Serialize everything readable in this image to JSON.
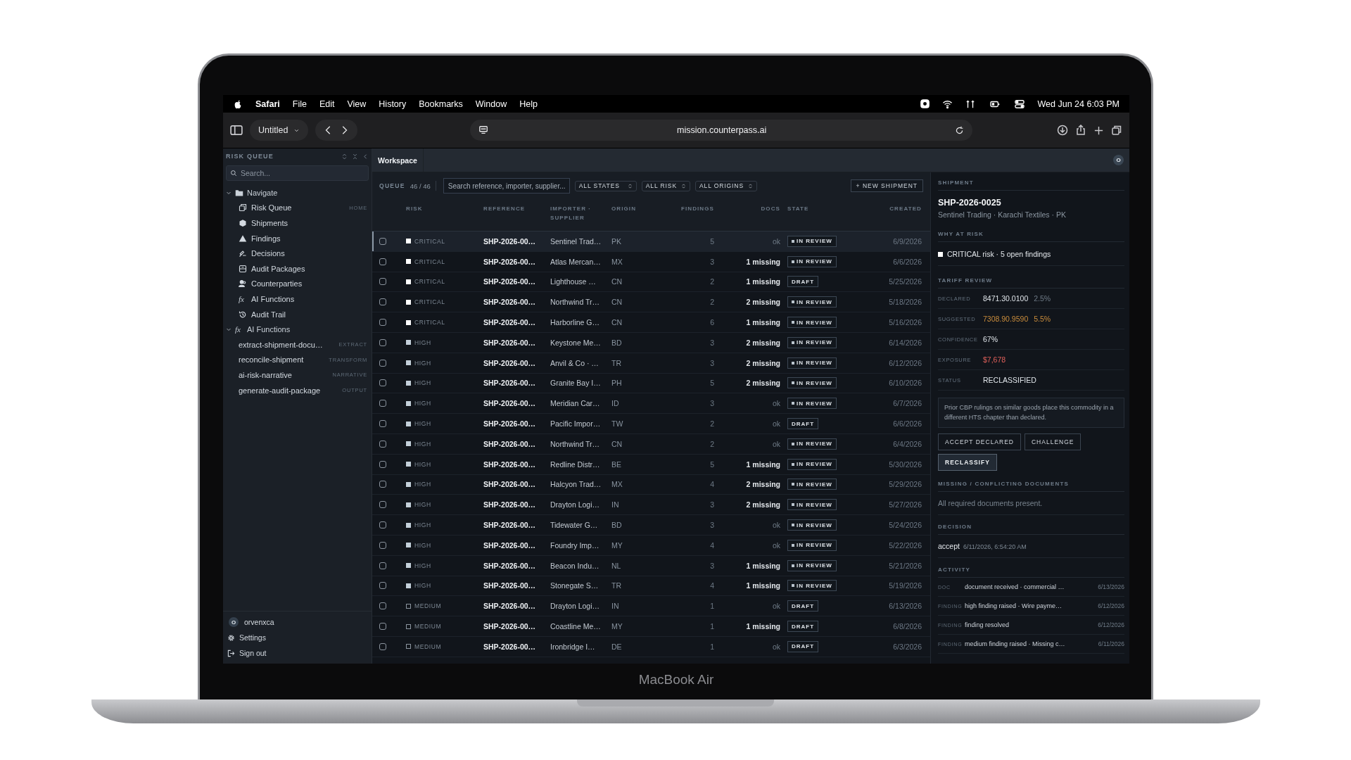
{
  "device": {
    "label": "MacBook Air"
  },
  "menu_bar": {
    "app": "Safari",
    "items": [
      "File",
      "Edit",
      "View",
      "History",
      "Bookmarks",
      "Window",
      "Help"
    ],
    "clock": "Wed Jun 24  6:03 PM"
  },
  "browser": {
    "tab_group": "Untitled",
    "url": "mission.counterpass.ai"
  },
  "sidebar": {
    "title": "RISK QUEUE",
    "search": {
      "placeholder": "Search..."
    },
    "groups": [
      {
        "label": "Navigate",
        "kind": "nav",
        "expanded": true,
        "children": [
          {
            "label": "Risk Queue",
            "tag": "HOME"
          },
          {
            "label": "Shipments"
          },
          {
            "label": "Findings"
          },
          {
            "label": "Decisions"
          },
          {
            "label": "Audit Packages"
          },
          {
            "label": "Counterparties"
          },
          {
            "label": "AI Functions",
            "glyph": "fx"
          },
          {
            "label": "Audit Trail"
          }
        ]
      },
      {
        "label": "AI Functions",
        "kind": "functions",
        "glyph": "fx",
        "expanded": true,
        "children": [
          {
            "label": "extract-shipment-docu…",
            "tag": "EXTRACT"
          },
          {
            "label": "reconcile-shipment",
            "tag": "TRANSFORM"
          },
          {
            "label": "ai-risk-narrative",
            "tag": "NARRATIVE"
          },
          {
            "label": "generate-audit-package",
            "tag": "OUTPUT"
          }
        ]
      }
    ],
    "user": {
      "initial": "O",
      "name": "orvenxca"
    },
    "footer": [
      "Settings",
      "Sign out"
    ]
  },
  "workspace": {
    "tab": "Workspace",
    "avatar": "O"
  },
  "queue": {
    "label": "QUEUE",
    "count": "46 / 46",
    "search": {
      "placeholder": "Search reference, importer, supplier..."
    },
    "filters": [
      "ALL STATES",
      "ALL RISK",
      "ALL ORIGINS"
    ],
    "new_button": "+ NEW SHIPMENT"
  },
  "table": {
    "columns": [
      "RISK",
      "REFERENCE",
      "IMPORTER · SUPPLIER",
      "ORIGIN",
      "FINDINGS",
      "DOCS",
      "STATE",
      "CREATED"
    ],
    "rows": [
      {
        "selected": true,
        "checked": false,
        "kind": "critical",
        "risk": "CRITICAL",
        "reference": "SHP-2026-00…",
        "importer": "Sentinel Trad…",
        "origin": "PK",
        "findings": "5",
        "docs": "ok",
        "docs_missing": false,
        "state": "IN REVIEW",
        "dot": true,
        "created": "6/9/2026"
      },
      {
        "selected": false,
        "checked": false,
        "kind": "critical",
        "risk": "CRITICAL",
        "reference": "SHP-2026-00…",
        "importer": "Atlas Mercan…",
        "origin": "MX",
        "findings": "3",
        "docs": "1 missing",
        "docs_missing": true,
        "state": "IN REVIEW",
        "dot": true,
        "created": "6/6/2026"
      },
      {
        "selected": false,
        "checked": false,
        "kind": "critical",
        "risk": "CRITICAL",
        "reference": "SHP-2026-00…",
        "importer": "Lighthouse …",
        "origin": "CN",
        "findings": "2",
        "docs": "1 missing",
        "docs_missing": true,
        "state": "DRAFT",
        "dot": false,
        "created": "5/25/2026"
      },
      {
        "selected": false,
        "checked": false,
        "kind": "critical",
        "risk": "CRITICAL",
        "reference": "SHP-2026-00…",
        "importer": "Northwind Tr…",
        "origin": "CN",
        "findings": "2",
        "docs": "2 missing",
        "docs_missing": true,
        "state": "IN REVIEW",
        "dot": true,
        "created": "5/18/2026"
      },
      {
        "selected": false,
        "checked": false,
        "kind": "critical",
        "risk": "CRITICAL",
        "reference": "SHP-2026-00…",
        "importer": "Harborline G…",
        "origin": "CN",
        "findings": "6",
        "docs": "1 missing",
        "docs_missing": true,
        "state": "IN REVIEW",
        "dot": true,
        "created": "5/16/2026"
      },
      {
        "selected": false,
        "checked": false,
        "kind": "high",
        "risk": "HIGH",
        "reference": "SHP-2026-00…",
        "importer": "Keystone Me…",
        "origin": "BD",
        "findings": "3",
        "docs": "2 missing",
        "docs_missing": true,
        "state": "IN REVIEW",
        "dot": true,
        "created": "6/14/2026"
      },
      {
        "selected": false,
        "checked": false,
        "kind": "high",
        "risk": "HIGH",
        "reference": "SHP-2026-00…",
        "importer": "Anvil & Co · …",
        "origin": "TR",
        "findings": "3",
        "docs": "2 missing",
        "docs_missing": true,
        "state": "IN REVIEW",
        "dot": true,
        "created": "6/12/2026"
      },
      {
        "selected": false,
        "checked": false,
        "kind": "high",
        "risk": "HIGH",
        "reference": "SHP-2026-00…",
        "importer": "Granite Bay I…",
        "origin": "PH",
        "findings": "5",
        "docs": "2 missing",
        "docs_missing": true,
        "state": "IN REVIEW",
        "dot": true,
        "created": "6/10/2026"
      },
      {
        "selected": false,
        "checked": false,
        "kind": "high",
        "risk": "HIGH",
        "reference": "SHP-2026-00…",
        "importer": "Meridian Car…",
        "origin": "ID",
        "findings": "3",
        "docs": "ok",
        "docs_missing": false,
        "state": "IN REVIEW",
        "dot": true,
        "created": "6/7/2026"
      },
      {
        "selected": false,
        "checked": false,
        "kind": "high",
        "risk": "HIGH",
        "reference": "SHP-2026-00…",
        "importer": "Pacific Impor…",
        "origin": "TW",
        "findings": "2",
        "docs": "ok",
        "docs_missing": false,
        "state": "DRAFT",
        "dot": false,
        "created": "6/6/2026"
      },
      {
        "selected": false,
        "checked": false,
        "kind": "high",
        "risk": "HIGH",
        "reference": "SHP-2026-00…",
        "importer": "Northwind Tr…",
        "origin": "CN",
        "findings": "2",
        "docs": "ok",
        "docs_missing": false,
        "state": "IN REVIEW",
        "dot": true,
        "created": "6/4/2026"
      },
      {
        "selected": false,
        "checked": false,
        "kind": "high",
        "risk": "HIGH",
        "reference": "SHP-2026-00…",
        "importer": "Redline Distr…",
        "origin": "BE",
        "findings": "5",
        "docs": "1 missing",
        "docs_missing": true,
        "state": "IN REVIEW",
        "dot": true,
        "created": "5/30/2026"
      },
      {
        "selected": false,
        "checked": false,
        "kind": "high",
        "risk": "HIGH",
        "reference": "SHP-2026-00…",
        "importer": "Halcyon Trad…",
        "origin": "MX",
        "findings": "4",
        "docs": "2 missing",
        "docs_missing": true,
        "state": "IN REVIEW",
        "dot": true,
        "created": "5/29/2026"
      },
      {
        "selected": false,
        "checked": false,
        "kind": "high",
        "risk": "HIGH",
        "reference": "SHP-2026-00…",
        "importer": "Drayton Logi…",
        "origin": "IN",
        "findings": "3",
        "docs": "2 missing",
        "docs_missing": true,
        "state": "IN REVIEW",
        "dot": true,
        "created": "5/27/2026"
      },
      {
        "selected": false,
        "checked": false,
        "kind": "high",
        "risk": "HIGH",
        "reference": "SHP-2026-00…",
        "importer": "Tidewater G…",
        "origin": "BD",
        "findings": "3",
        "docs": "ok",
        "docs_missing": false,
        "state": "IN REVIEW",
        "dot": true,
        "created": "5/24/2026"
      },
      {
        "selected": false,
        "checked": false,
        "kind": "high",
        "risk": "HIGH",
        "reference": "SHP-2026-00…",
        "importer": "Foundry Imp…",
        "origin": "MY",
        "findings": "4",
        "docs": "ok",
        "docs_missing": false,
        "state": "IN REVIEW",
        "dot": true,
        "created": "5/22/2026"
      },
      {
        "selected": false,
        "checked": false,
        "kind": "high",
        "risk": "HIGH",
        "reference": "SHP-2026-00…",
        "importer": "Beacon Indu…",
        "origin": "NL",
        "findings": "3",
        "docs": "1 missing",
        "docs_missing": true,
        "state": "IN REVIEW",
        "dot": true,
        "created": "5/21/2026"
      },
      {
        "selected": false,
        "checked": false,
        "kind": "high",
        "risk": "HIGH",
        "reference": "SHP-2026-00…",
        "importer": "Stonegate S…",
        "origin": "TR",
        "findings": "4",
        "docs": "1 missing",
        "docs_missing": true,
        "state": "IN REVIEW",
        "dot": true,
        "created": "5/19/2026"
      },
      {
        "selected": false,
        "checked": false,
        "kind": "medium",
        "risk": "MEDIUM",
        "reference": "SHP-2026-00…",
        "importer": "Drayton Logi…",
        "origin": "IN",
        "findings": "1",
        "docs": "ok",
        "docs_missing": false,
        "state": "DRAFT",
        "dot": false,
        "created": "6/13/2026"
      },
      {
        "selected": false,
        "checked": false,
        "kind": "medium",
        "risk": "MEDIUM",
        "reference": "SHP-2026-00…",
        "importer": "Coastline Me…",
        "origin": "MY",
        "findings": "1",
        "docs": "1 missing",
        "docs_missing": true,
        "state": "DRAFT",
        "dot": false,
        "created": "6/8/2026"
      },
      {
        "selected": false,
        "checked": false,
        "kind": "medium",
        "risk": "MEDIUM",
        "reference": "SHP-2026-00…",
        "importer": "Ironbridge I…",
        "origin": "DE",
        "findings": "1",
        "docs": "ok",
        "docs_missing": false,
        "state": "DRAFT",
        "dot": false,
        "created": "6/3/2026"
      }
    ]
  },
  "detail": {
    "section_title": "SHIPMENT",
    "id": "SHP-2026-0025",
    "subtitle": "Sentinel Trading · Karachi Textiles · PK",
    "why_title": "WHY AT RISK",
    "why": "CRITICAL risk · 5 open findings",
    "tariff_title": "TARIFF REVIEW",
    "tariff": [
      {
        "label": "DECLARED",
        "value": "8471.30.0100",
        "extra": "2.5%",
        "kind": "normal"
      },
      {
        "label": "SUGGESTED",
        "value": "7308.90.9590",
        "extra": "5.5%",
        "kind": "warning"
      },
      {
        "label": "CONFIDENCE",
        "value": "67%",
        "kind": "normal"
      },
      {
        "label": "EXPOSURE",
        "value": "$7,678",
        "kind": "danger"
      },
      {
        "label": "STATUS",
        "value": "RECLASSIFIED",
        "kind": "normal"
      }
    ],
    "note": "Prior CBP rulings on similar goods place this commodity in a different HTS chapter than declared.",
    "actions": [
      {
        "label": "ACCEPT DECLARED",
        "selected": false
      },
      {
        "label": "CHALLENGE",
        "selected": false
      },
      {
        "label": "RECLASSIFY",
        "selected": true
      }
    ],
    "documents_title": "MISSING / CONFLICTING DOCUMENTS",
    "documents": "All required documents present.",
    "decision_title": "DECISION",
    "decision": {
      "value": "accept",
      "time": "6/11/2026, 6:54:20 AM"
    },
    "activity_title": "ACTIVITY",
    "activity": [
      {
        "type": "DOC",
        "text": "document received · commercial …",
        "date": "6/13/2026"
      },
      {
        "type": "FINDING",
        "text": "high finding raised · Wire payme…",
        "date": "6/12/2026"
      },
      {
        "type": "FINDING",
        "text": "finding resolved",
        "date": "6/12/2026"
      },
      {
        "type": "FINDING",
        "text": "medium finding raised · Missing c…",
        "date": "6/11/2026"
      }
    ]
  }
}
